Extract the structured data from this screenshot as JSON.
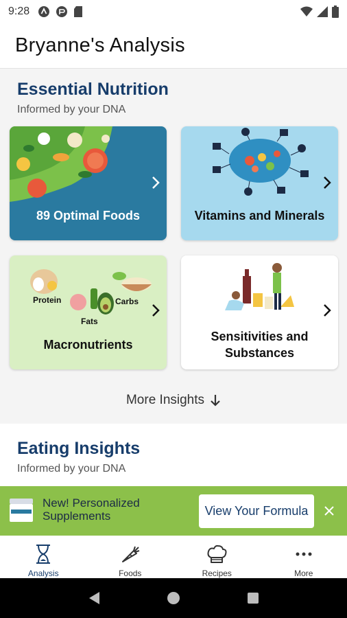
{
  "status_bar": {
    "time": "9:28",
    "left_icons": [
      "assistant-icon",
      "media-icon",
      "sd-card-icon"
    ],
    "right_icons": [
      "wifi-icon",
      "cell-signal-icon",
      "battery-icon"
    ]
  },
  "header": {
    "title": "Bryanne's Analysis"
  },
  "essential": {
    "title": "Essential Nutrition",
    "subtitle": "Informed by your DNA",
    "cards": [
      {
        "label": "89 Optimal Foods",
        "bg": "#2a7aa0",
        "text_color": "#ffffff"
      },
      {
        "label": "Vitamins and Minerals",
        "bg": "#a6d9ee",
        "text_color": "#111111"
      },
      {
        "label": "Macronutrients",
        "bg": "#d9efc3",
        "text_color": "#111111",
        "tags": {
          "protein": "Protein",
          "carbs": "Carbs",
          "fats": "Fats"
        }
      },
      {
        "label": "Sensitivities and Substances",
        "bg": "#ffffff",
        "text_color": "#111111"
      }
    ]
  },
  "more_insights": {
    "label": "More Insights"
  },
  "eating": {
    "title": "Eating Insights",
    "subtitle": "Informed by your DNA"
  },
  "promo": {
    "text": "New! Personalized Supplements",
    "button": "View Your Formula",
    "bg": "#8cc04a"
  },
  "bottom_nav": {
    "items": [
      {
        "label": "Analysis",
        "icon": "hourglass-icon",
        "active": true
      },
      {
        "label": "Foods",
        "icon": "carrot-icon",
        "active": false
      },
      {
        "label": "Recipes",
        "icon": "chef-hat-icon",
        "active": false
      },
      {
        "label": "More",
        "icon": "more-dots-icon",
        "active": false
      }
    ]
  },
  "colors": {
    "brand_navy": "#173d6b",
    "accent_green": "#8cc04a"
  }
}
